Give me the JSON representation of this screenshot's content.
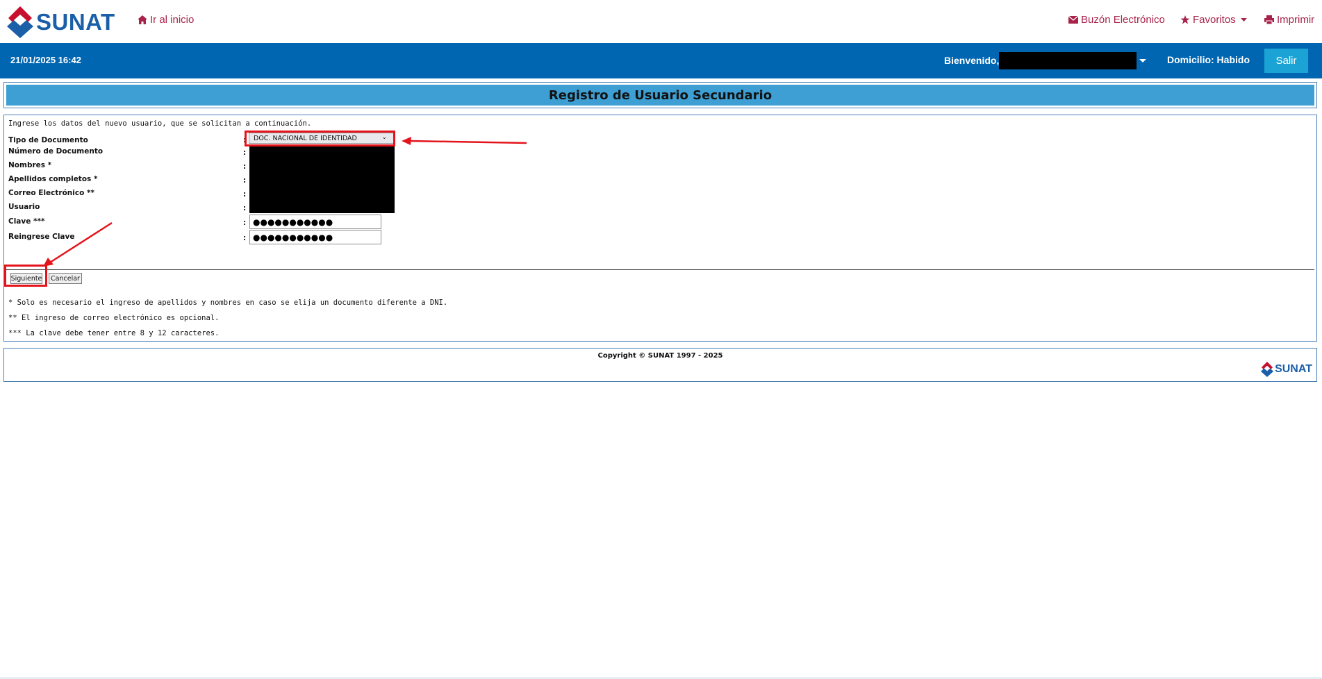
{
  "header": {
    "brand": "SUNAT",
    "home_link": "Ir al inicio",
    "inbox_link": "Buzón Electrónico",
    "favorites_link": "Favoritos",
    "print_link": "Imprimir"
  },
  "session_bar": {
    "datetime": "21/01/2025 16:42",
    "welcome_label": "Bienvenido,",
    "domicilio": "Domicilio: Habido",
    "logout_label": "Salir"
  },
  "page_title": "Registro de Usuario Secundario",
  "form": {
    "intro": "Ingrese los datos del nuevo usuario, que se solicitan a continuación.",
    "fields": [
      {
        "label": "Tipo de Documento"
      },
      {
        "label": "Número de Documento"
      },
      {
        "label": "Nombres *"
      },
      {
        "label": "Apellidos completos *"
      },
      {
        "label": "Correo Electrónico **"
      },
      {
        "label": "Usuario"
      },
      {
        "label": "Clave ***"
      },
      {
        "label": "Reingrese Clave"
      }
    ],
    "colon": ":",
    "document_type_selected": "DOC. NACIONAL DE IDENTIDAD",
    "password_mask": "●●●●●●●●●●●",
    "repassword_mask": "●●●●●●●●●●●",
    "next_button": "Siguiente",
    "cancel_button": "Cancelar"
  },
  "notes": [
    "* Solo es necesario el ingreso de apellidos y nombres en caso se elija un documento diferente a DNI.",
    "** El ingreso de correo electrónico es opcional.",
    "*** La clave debe tener entre 8 y 12 caracteres."
  ],
  "footer": {
    "copyright": "Copyright © SUNAT 1997 - 2025",
    "brand": "SUNAT"
  },
  "colors": {
    "brand_blue": "#1b5fa8",
    "brand_red": "#c8102e",
    "nav_link": "#a8234c",
    "session_bar": "#0066b1",
    "logout_button": "#1aa3d4",
    "title_bar": "#3d9fd3",
    "annotation_red": "#e3141b"
  }
}
